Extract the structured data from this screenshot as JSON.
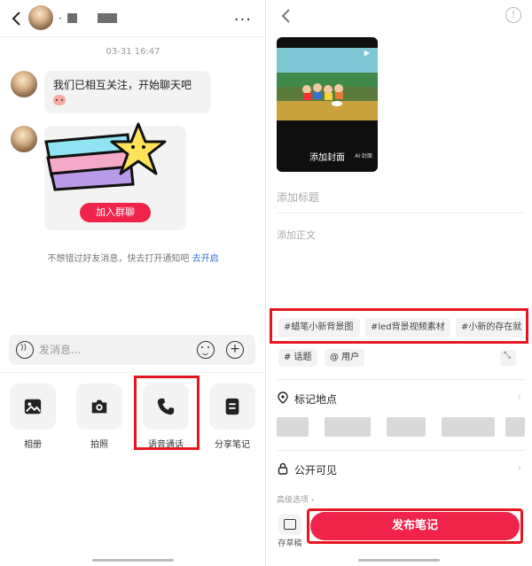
{
  "left": {
    "header": {
      "contact_name": "·",
      "more_label": "···"
    },
    "timestamp": "03-31 16:47",
    "messages": [
      {
        "text": "我们已相互关注，开始聊天吧"
      }
    ],
    "group_card": {
      "join_label": "加入群聊"
    },
    "notify": {
      "text": "不想错过好友消息，快去打开通知吧",
      "link": "去开启"
    },
    "input": {
      "placeholder": "发消息..."
    },
    "tools": [
      {
        "label": "相册",
        "icon": "image-icon"
      },
      {
        "label": "拍照",
        "icon": "camera-icon"
      },
      {
        "label": "语音通话",
        "icon": "phone-icon"
      },
      {
        "label": "分享笔记",
        "icon": "note-icon"
      }
    ]
  },
  "right": {
    "cover_label": "添加封面",
    "ai_tag": "AI·封面",
    "title_placeholder": "添加标题",
    "body_placeholder": "添加正文",
    "tags": [
      "#蜡笔小新背景图",
      "#led背景视频素材",
      "#小新的存在就"
    ],
    "topic_label": "# 话题",
    "user_label": "@ 用户",
    "location_label": "标记地点",
    "visibility_label": "公开可见",
    "advanced_label": "高级选项 ›",
    "draft_label": "存草稿",
    "publish_label": "发布笔记"
  },
  "colors": {
    "brand_red": "#f0244a",
    "highlight_red": "#e5161f",
    "link_blue": "#3b6fd8"
  }
}
